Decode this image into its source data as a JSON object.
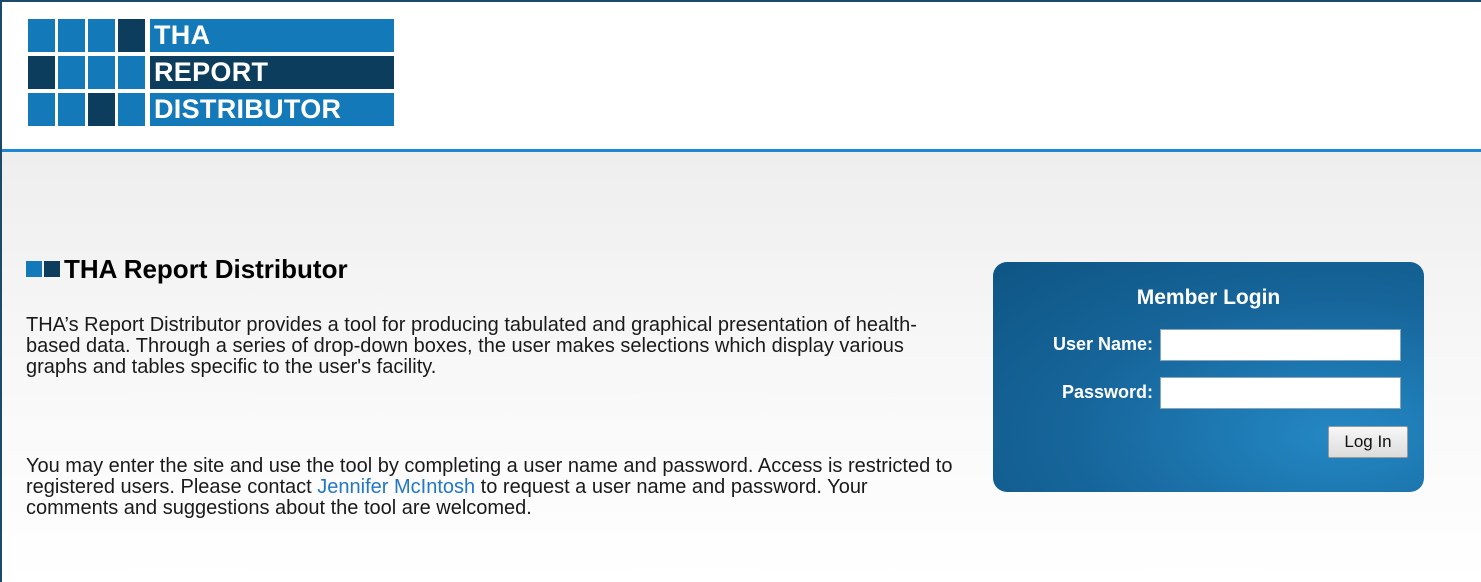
{
  "header": {
    "logo_lines": [
      "THA",
      "REPORT",
      "DISTRIBUTOR"
    ],
    "colors": {
      "light_blue": "#1479b8",
      "dark_navy": "#0c3d5c",
      "rule": "#1a8ad4"
    }
  },
  "main": {
    "title": "THA Report Distributor",
    "paragraph1": "THA’s Report Distributor provides a tool for producing tabulated and graphical presentation of health-based data. Through a series of drop-down boxes, the user makes selections which display various graphs and tables specific to the user's facility.",
    "paragraph2_before": "You may enter the site and use the tool by completing a user name and password. Access is restricted to registered users. Please contact ",
    "contact_link": "Jennifer McIntosh",
    "paragraph2_after": " to request a user name and password. Your comments and suggestions about the tool are welcomed."
  },
  "login": {
    "title": "Member Login",
    "username_label": "User Name:",
    "username_value": "",
    "password_label": "Password:",
    "password_value": "",
    "button_label": "Log In"
  }
}
